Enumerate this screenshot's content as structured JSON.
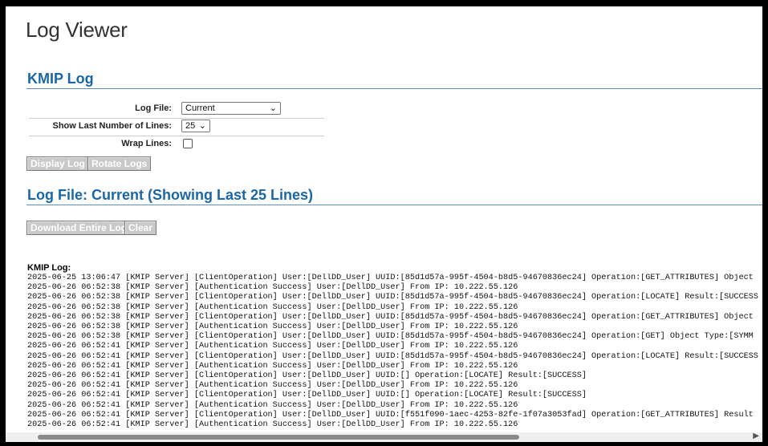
{
  "page": {
    "title": "Log Viewer"
  },
  "section": {
    "title": "KMIP Log"
  },
  "form": {
    "log_file_label": "Log File:",
    "log_file_value": "Current",
    "lines_label": "Show Last Number of Lines:",
    "lines_value": "25",
    "wrap_label": "Wrap Lines:",
    "wrap_checked": false
  },
  "buttons": {
    "display_log": "Display Log",
    "rotate_logs": "Rotate Logs",
    "download": "Download Entire Log",
    "clear": "Clear"
  },
  "log_section": {
    "title": "Log File: Current (Showing Last 25 Lines)"
  },
  "log": {
    "label": "KMIP Log:",
    "lines": [
      "2025-06-25 13:06:47 [KMIP Server] [ClientOperation] User:[DellDD_User] UUID:[85d1d57a-995f-4504-b8d5-94670836ec24] Operation:[GET_ATTRIBUTES] Object",
      "2025-06-26 06:52:38 [KMIP Server] [Authentication Success] User:[DellDD_User] From IP: 10.222.55.126",
      "2025-06-26 06:52:38 [KMIP Server] [ClientOperation] User:[DellDD_User] UUID:[85d1d57a-995f-4504-b8d5-94670836ec24] Operation:[LOCATE] Result:[SUCCESS",
      "2025-06-26 06:52:38 [KMIP Server] [Authentication Success] User:[DellDD_User] From IP: 10.222.55.126",
      "2025-06-26 06:52:38 [KMIP Server] [ClientOperation] User:[DellDD_User] UUID:[85d1d57a-995f-4504-b8d5-94670836ec24] Operation:[GET_ATTRIBUTES] Object",
      "2025-06-26 06:52:38 [KMIP Server] [Authentication Success] User:[DellDD_User] From IP: 10.222.55.126",
      "2025-06-26 06:52:38 [KMIP Server] [ClientOperation] User:[DellDD_User] UUID:[85d1d57a-995f-4504-b8d5-94670836ec24] Operation:[GET] Object Type:[SYMM",
      "2025-06-26 06:52:41 [KMIP Server] [Authentication Success] User:[DellDD_User] From IP: 10.222.55.126",
      "2025-06-26 06:52:41 [KMIP Server] [ClientOperation] User:[DellDD_User] UUID:[85d1d57a-995f-4504-b8d5-94670836ec24] Operation:[LOCATE] Result:[SUCCESS",
      "2025-06-26 06:52:41 [KMIP Server] [Authentication Success] User:[DellDD_User] From IP: 10.222.55.126",
      "2025-06-26 06:52:41 [KMIP Server] [ClientOperation] User:[DellDD_User] UUID:[] Operation:[LOCATE] Result:[SUCCESS]",
      "2025-06-26 06:52:41 [KMIP Server] [Authentication Success] User:[DellDD_User] From IP: 10.222.55.126",
      "2025-06-26 06:52:41 [KMIP Server] [ClientOperation] User:[DellDD_User] UUID:[] Operation:[LOCATE] Result:[SUCCESS]",
      "2025-06-26 06:52:41 [KMIP Server] [Authentication Success] User:[DellDD_User] From IP: 10.222.55.126",
      "2025-06-26 06:52:41 [KMIP Server] [ClientOperation] User:[DellDD_User] UUID:[f551f090-1aec-4253-82fe-1f07a3053fad] Operation:[GET_ATTRIBUTES] Result",
      "2025-06-26 06:52:41 [KMIP Server] [Authentication Success] User:[DellDD_User] From IP: 10.222.55.126"
    ]
  },
  "icons": {
    "dropdown": "chevron-down-icon",
    "scroll_right": "arrow-right-icon"
  }
}
